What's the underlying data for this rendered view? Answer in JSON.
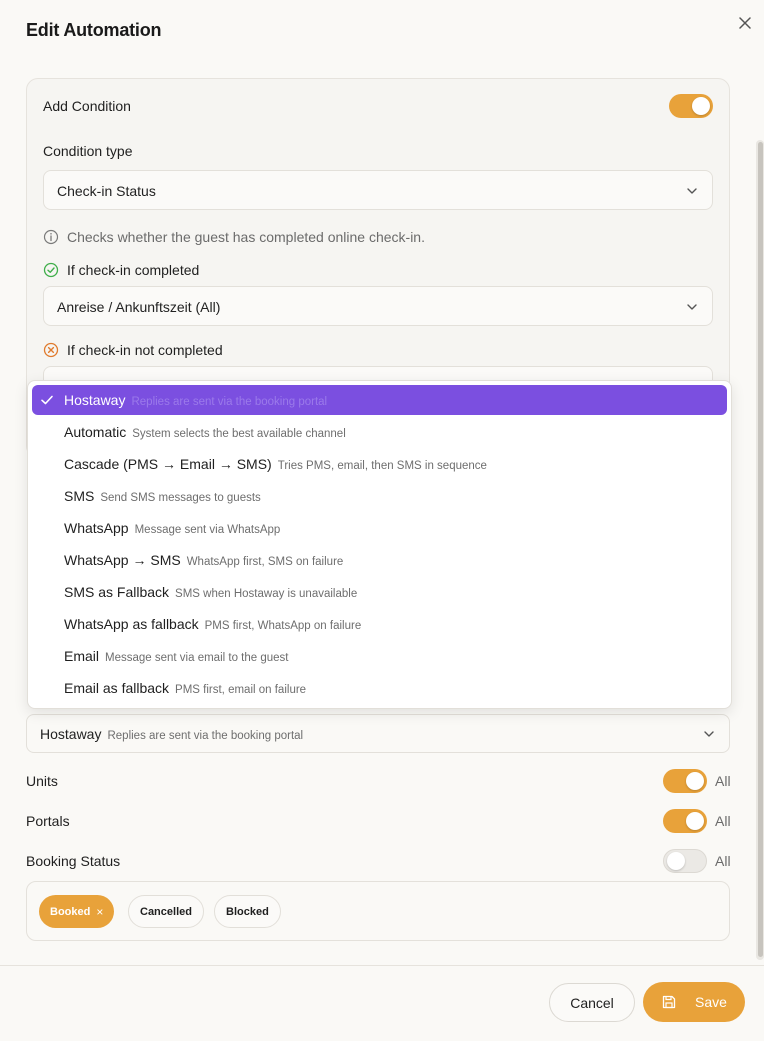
{
  "header": {
    "title": "Edit Automation"
  },
  "condition": {
    "add_condition_label": "Add Condition",
    "add_condition_on": true,
    "condition_type_label": "Condition type",
    "condition_type_value": "Check-in Status",
    "info_text": "Checks whether the guest has completed online check-in.",
    "completed_label": "If check-in completed",
    "completed_value": "Anreise / Ankunftszeit (All)",
    "not_completed_label": "If check-in not completed"
  },
  "channel_dropdown": {
    "options": [
      {
        "label": "Hostaway",
        "desc": "Replies are sent via the booking portal",
        "selected": true
      },
      {
        "label": "Automatic",
        "desc": "System selects the best available channel",
        "selected": false
      },
      {
        "label": "Cascade (PMS → Email → SMS)",
        "desc": "Tries PMS, email, then SMS in sequence",
        "selected": false
      },
      {
        "label": "SMS",
        "desc": "Send SMS messages to guests",
        "selected": false
      },
      {
        "label": "WhatsApp",
        "desc": "Message sent via WhatsApp",
        "selected": false
      },
      {
        "label": "WhatsApp → SMS",
        "desc": "WhatsApp first, SMS on failure",
        "selected": false
      },
      {
        "label": "SMS as Fallback",
        "desc": "SMS when Hostaway is unavailable",
        "selected": false
      },
      {
        "label": "WhatsApp as fallback",
        "desc": "PMS first, WhatsApp on failure",
        "selected": false
      },
      {
        "label": "Email",
        "desc": "Message sent via email to the guest",
        "selected": false
      },
      {
        "label": "Email as fallback",
        "desc": "PMS first, email on failure",
        "selected": false
      }
    ]
  },
  "channel_select": {
    "label": "Hostaway",
    "desc": "Replies are sent via the booking portal"
  },
  "filters": {
    "units_label": "Units",
    "units_on": true,
    "units_all": "All",
    "portals_label": "Portals",
    "portals_on": true,
    "portals_all": "All",
    "booking_status_label": "Booking Status",
    "booking_status_on": false,
    "booking_status_all": "All"
  },
  "status_chips": [
    {
      "label": "Booked",
      "active": true,
      "remove": "×"
    },
    {
      "label": "Cancelled",
      "active": false
    },
    {
      "label": "Blocked",
      "active": false
    }
  ],
  "footer": {
    "cancel_label": "Cancel",
    "save_label": "Save"
  },
  "colors": {
    "accent": "#e8a23a",
    "selected": "#7b4fe0",
    "success": "#3fae4a",
    "error": "#e07b2e"
  }
}
